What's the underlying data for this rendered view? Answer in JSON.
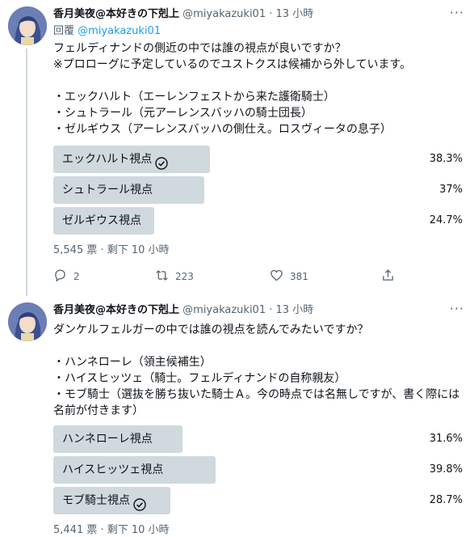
{
  "tweets": [
    {
      "author": {
        "name": "香月美夜@本好きの下剋上",
        "handle": "@miyakazuki01",
        "dot": "·",
        "time": "13 小時"
      },
      "reply_to": {
        "prefix": "回覆",
        "mention": "@miyakazuki01"
      },
      "text": "フェルディナンドの側近の中では誰の視点が良いですか？\n※プロローグに予定しているのでユストクスは候補から外しています。\n\n・エックハルト（エーレンフェストから来た護衛騎士）\n・シュトラール（元アーレンスバッハの騎士団長）\n・ゼルギウス（アーレンスバッハの側仕え。ロスヴィータの息子）",
      "poll": {
        "options": [
          {
            "label": "エックハルト視点",
            "percent": "38.3%",
            "share": 38.3,
            "selected": true
          },
          {
            "label": "シュトラール視点",
            "percent": "37%",
            "share": 37,
            "selected": false
          },
          {
            "label": "ゼルギウス視点",
            "percent": "24.7%",
            "share": 24.7,
            "selected": false
          }
        ],
        "meta": "5,545 票 · 剩下 10 小時"
      },
      "actions": {
        "replies": "2",
        "retweets": "223",
        "likes": "381"
      }
    },
    {
      "author": {
        "name": "香月美夜@本好きの下剋上",
        "handle": "@miyakazuki01",
        "dot": "·",
        "time": "13 小時"
      },
      "text": "ダンケルフェルガーの中では誰の視点を読んでみたいですか？\n\n・ハンネローレ（領主候補生）\n・ハイスヒッツェ（騎士。フェルディナンドの自称親友）\n・モブ騎士（選抜を勝ち抜いた騎士Ａ。今の時点では名無しですが、書く際には名前が付きます）",
      "poll": {
        "options": [
          {
            "label": "ハンネローレ視点",
            "percent": "31.6%",
            "share": 31.6,
            "selected": false
          },
          {
            "label": "ハイスヒッツェ視点",
            "percent": "39.8%",
            "share": 39.8,
            "selected": false
          },
          {
            "label": "モブ騎士視点",
            "percent": "28.7%",
            "share": 28.7,
            "selected": true
          }
        ],
        "meta": "5,441 票 · 剩下 10 小時"
      }
    }
  ],
  "icons": {
    "more": "more-icon",
    "check": "check-circle-icon",
    "reply": "reply-icon",
    "retweet": "retweet-icon",
    "like": "heart-icon",
    "share": "share-icon"
  },
  "colors": {
    "poll_bar": "#cfd9de",
    "link": "#1d9bf0",
    "secondary_text": "#536471"
  },
  "more_glyph": "···"
}
